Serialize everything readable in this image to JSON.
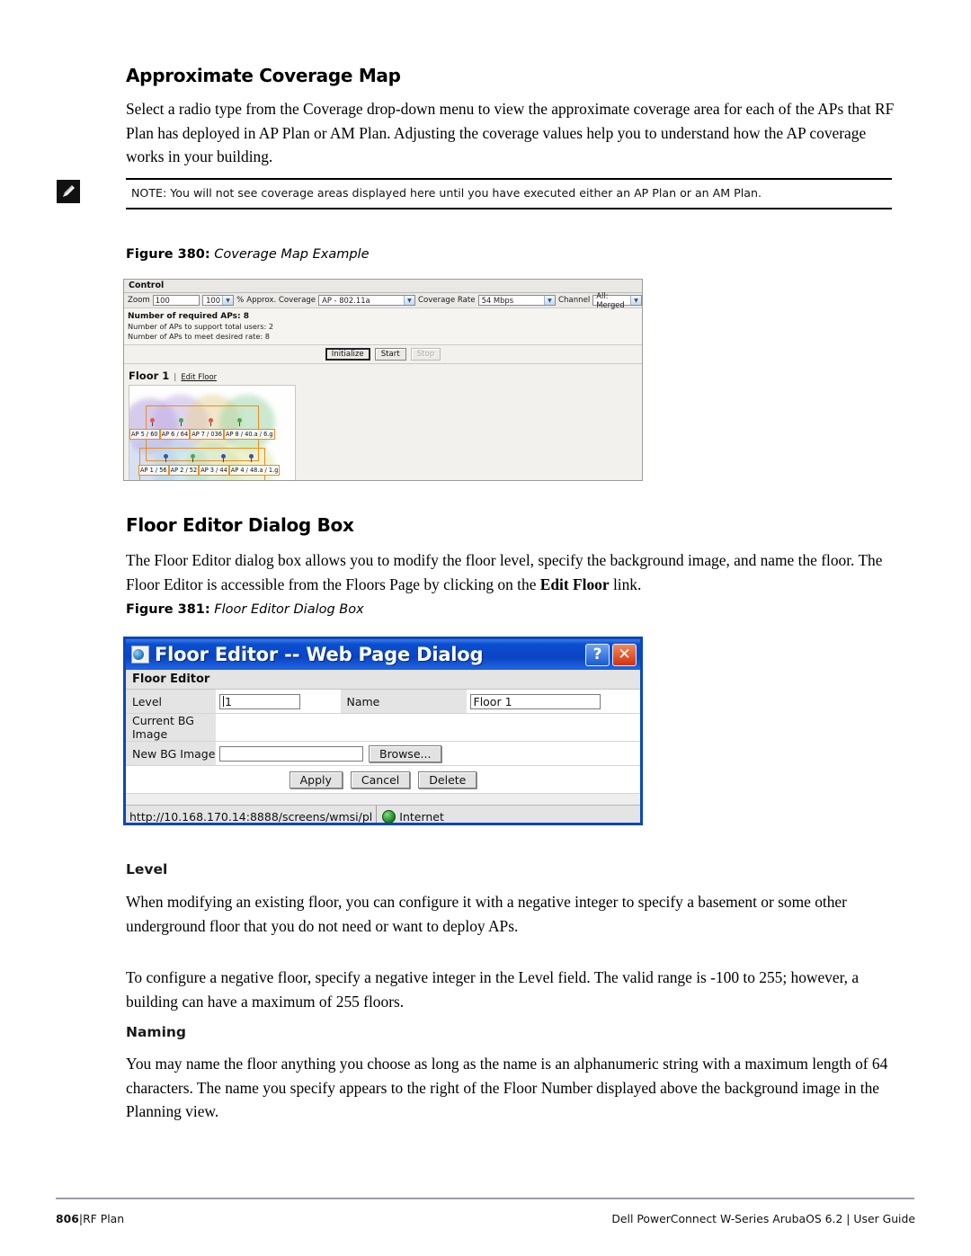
{
  "section1": {
    "heading": "Approximate Coverage Map",
    "paragraph": "Select a radio type from the Coverage drop-down menu to view the approximate coverage area for each of the APs that RF Plan has deployed in AP Plan or AM Plan. Adjusting the coverage values help you to understand how the AP coverage works in your building.",
    "note": "NOTE: You will not see coverage areas displayed here until you have executed either an AP Plan or an AM Plan.",
    "note_icon": "pencil-note-icon"
  },
  "figure380": {
    "caption_number": "Figure 380:",
    "caption_label": "Coverage Map Example",
    "control": {
      "panel_title": "Control",
      "zoom_label": "Zoom",
      "zoom_value": "100",
      "zoom_select_value": "100",
      "percent_label": "%",
      "approx_coverage_label": "Approx. Coverage",
      "approx_coverage_value": "AP - 802.11a",
      "coverage_rate_label": "Coverage Rate",
      "coverage_rate_value": "54 Mbps",
      "channel_label": "Channel",
      "channel_value": "All: Merged",
      "required_aps": "Number of required APs: 8",
      "aps_total_users": "Number of APs to support total users: 2",
      "aps_desired_rate": "Number of APs to meet desired rate: 8",
      "btn_initialize": "Initialize",
      "btn_start": "Start",
      "btn_stop": "Stop"
    },
    "floor": {
      "name": "Floor 1",
      "separator": "|",
      "edit_link": "Edit Floor",
      "top_row_labels": [
        "AP 5 / 60",
        "AP 6 / 64",
        "AP 7 / 036",
        "AP 8 / 40.a / 6.g"
      ],
      "bottom_row_labels": [
        "AP 1 / 56",
        "AP 2 / 52",
        "AP 3 / 44",
        "AP 4 / 48.a / 1.g"
      ],
      "halo_colors": [
        "#b9a8e0",
        "#c8b4e8",
        "#e8d39a",
        "#9fd8a8",
        "#8fc7e8",
        "#a8d8e8",
        "#bfe0b0",
        "#d8e8a8"
      ]
    }
  },
  "section2": {
    "heading": "Floor Editor Dialog Box",
    "paragraph_part1": "The Floor Editor dialog box allows you to modify the floor level, specify the background image, and name the floor. The Floor Editor is accessible from the Floors Page by clicking on the ",
    "paragraph_bold": "Edit Floor",
    "paragraph_part2": " link."
  },
  "figure381": {
    "caption_number": "Figure 381:",
    "caption_label": "Floor Editor Dialog Box",
    "dialog": {
      "title": "Floor Editor -- Web Page Dialog",
      "help_button": "?",
      "close_button": "✕",
      "subheader": "Floor Editor",
      "level_label": "Level",
      "level_value": "1",
      "name_label": "Name",
      "name_value": "Floor 1",
      "current_bg_label": "Current BG Image",
      "current_bg_value": "",
      "new_bg_label": "New BG Image",
      "new_bg_value": "",
      "browse_button": "Browse...",
      "apply_button": "Apply",
      "cancel_button": "Cancel",
      "delete_button": "Delete",
      "status_url": "http://10.168.170.14:8888/screens/wmsi/pl",
      "status_zone": "Internet"
    }
  },
  "section3": {
    "heading": "Level",
    "paragraph1": "When modifying an existing floor, you can configure it with a negative integer to specify a basement or some other underground floor that you do not need or want to deploy APs.",
    "paragraph2": "To configure a negative floor, specify a negative integer in the Level field. The valid range is -100 to 255; however, a building can have a maximum of 255 floors."
  },
  "section4": {
    "heading": "Naming",
    "paragraph": "You may name the floor anything you choose as long as the name is an alphanumeric string with a maximum length of 64 characters. The name you specify appears to the right of the Floor Number displayed above the background image in the Planning view."
  },
  "footer": {
    "page_number": "806",
    "divider": "|",
    "chapter": "RF Plan",
    "product": "Dell PowerConnect W-Series ArubaOS 6.2 | User Guide"
  }
}
